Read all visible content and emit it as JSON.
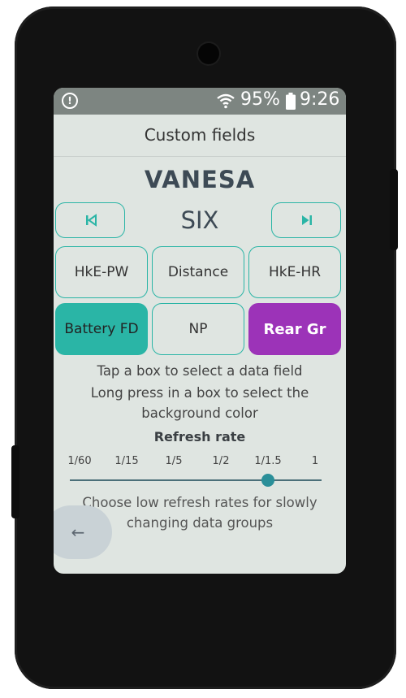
{
  "status_bar": {
    "alert_icon": "alert-circle-icon",
    "wifi_icon": "wifi-icon",
    "battery_percent": "95%",
    "battery_icon": "battery-icon",
    "time": "9:26"
  },
  "header": {
    "title": "Custom fields"
  },
  "profile": {
    "name": "VANESA",
    "page": "SIX",
    "prev_icon": "skip-previous-icon",
    "next_icon": "skip-next-icon"
  },
  "fields": [
    {
      "label": "HkE-PW",
      "color": "none"
    },
    {
      "label": "Distance",
      "color": "none"
    },
    {
      "label": "HkE-HR",
      "color": "none"
    },
    {
      "label": "Battery FD",
      "color": "#2ab5a6"
    },
    {
      "label": "NP",
      "color": "none"
    },
    {
      "label": "Rear Gr",
      "color": "#9c33b8"
    }
  ],
  "hints": {
    "tap": "Tap a box to select a data field",
    "long_press": "Long press in a box to select the background color"
  },
  "refresh": {
    "title": "Refresh rate",
    "options": [
      "1/60",
      "1/15",
      "1/5",
      "1/2",
      "1/1.5",
      "1"
    ],
    "selected": "1/1.5",
    "note": "Choose low refresh rates for slowly changing data groups"
  },
  "back": {
    "icon": "arrow-left-icon",
    "label": "←"
  },
  "colors": {
    "accent": "#2ab5a6",
    "highlight": "#9c33b8",
    "screen_bg": "#dfe5e1"
  }
}
